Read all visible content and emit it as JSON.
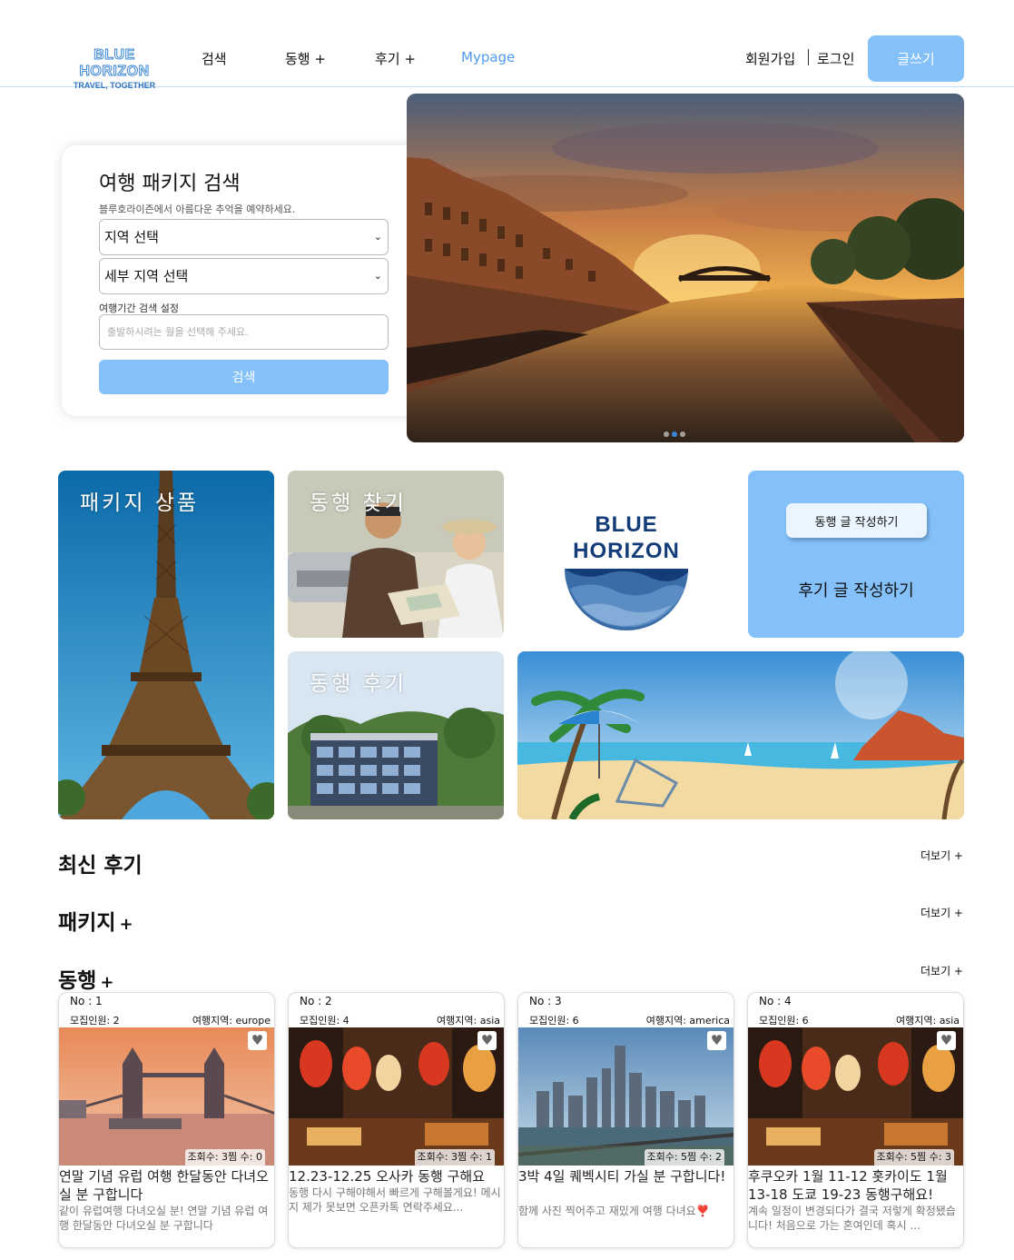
{
  "header": {
    "logo_main": "BLUE HORIZON",
    "logo_sub": "TRAVEL, TOGETHER",
    "nav": [
      {
        "label": "검색"
      },
      {
        "label": "동행 +"
      },
      {
        "label": "후기 +"
      },
      {
        "label": "Mypage"
      }
    ],
    "signup": "회원가입",
    "login": "로그인",
    "write_button": "글쓰기"
  },
  "search_panel": {
    "title": "여행 패키지 검색",
    "description": "블루호라이즌에서 아름다운 추억을 예약하세요.",
    "region_select": "지역 선택",
    "subregion_select": "세부 지역 선택",
    "period_label": "여행기간 검색 설정",
    "period_placeholder": "출발하시려는 월을 선택해 주세요.",
    "search_button": "검색"
  },
  "tiles": {
    "package": "패키지 상품",
    "find_companion": "동행 찾기",
    "companion_review": "동행 후기",
    "brand_line1": "BLUE",
    "brand_line2": "HORIZON",
    "write_companion": "동행 글 작성하기",
    "write_review": "후기 글 작성하기"
  },
  "sections": {
    "latest_reviews": "최신 후기",
    "packages": "패키지",
    "companions": "동행",
    "plus": "+",
    "more": "더보기 +"
  },
  "colors": {
    "accent": "#84c1fb",
    "active_nav": "#4d9cf0",
    "brand_navy": "#143c78"
  },
  "cards": [
    {
      "no": "No : 1",
      "recruit": "모집인원: 2",
      "region": "여행지역: europe",
      "stats": "조회수: 3찜 수: 0",
      "title": "연말 기념 유럽 여행 한달동안 다녀오실 분 구합니다",
      "desc": "같이 유럽여행 다녀오실 분! 연말 기념 유럽 여행 한달동안 다녀오실 분 구합니다",
      "image": "london-tower-bridge"
    },
    {
      "no": "No : 2",
      "recruit": "모집인원: 4",
      "region": "여행지역: asia",
      "stats": "조회수: 3찜 수: 1",
      "title": "12.23-12.25 오사카 동행 구해요",
      "desc": "동행 다시 구해야해서 빠르게 구해볼게요! 메시지 제가 못보면 오픈카톡 연락주세요...",
      "image": "osaka-alley"
    },
    {
      "no": "No : 3",
      "recruit": "모집인원: 6",
      "region": "여행지역: america",
      "stats": "조회수: 5찜 수: 2",
      "title": "3박 4일 퀘벡시티 가실 분 구합니다!",
      "desc": "함께 사진 찍어주고 재밌게 여행 다녀요❣️",
      "image": "new-york-skyline"
    },
    {
      "no": "No : 4",
      "recruit": "모집인원: 6",
      "region": "여행지역: asia",
      "stats": "조회수: 5찜 수: 3",
      "title": "후쿠오카 1월 11-12 홋카이도 1월 13-18 도쿄 19-23 동행구해요!",
      "desc": "계속 일정이 변경되다가 결국 저렇게 확정됐습니다! 처음으로 가는 혼여인데 혹시 ...",
      "image": "osaka-alley"
    }
  ]
}
